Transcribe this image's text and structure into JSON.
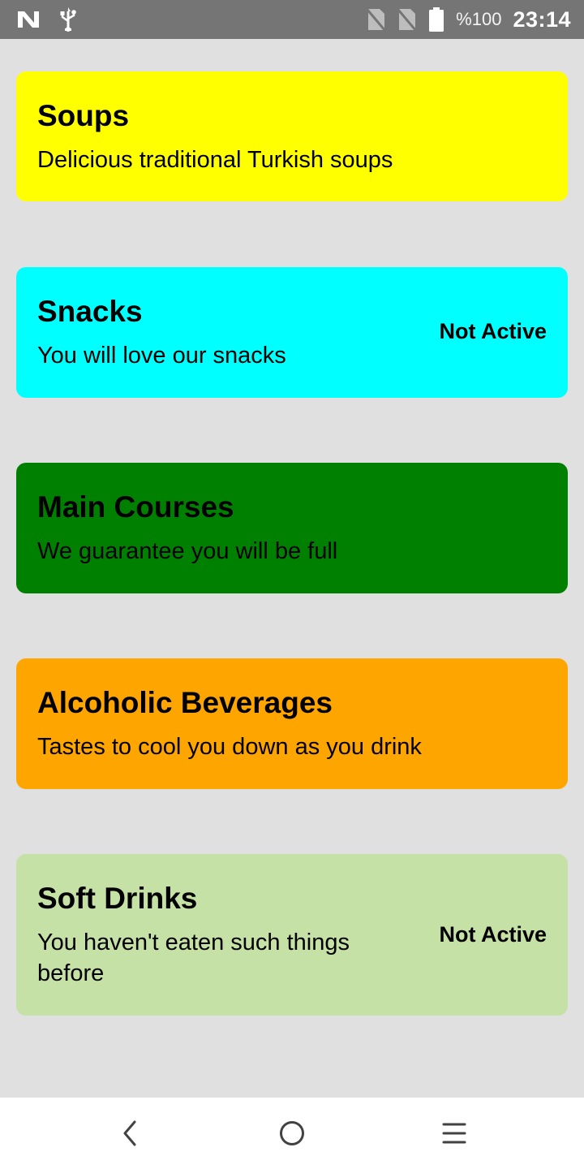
{
  "status_bar": {
    "battery_percent": "%100",
    "time": "23:14",
    "icons": [
      "n-notification-icon",
      "usb-icon",
      "no-sim-icon",
      "no-sim-icon",
      "battery-icon"
    ]
  },
  "categories": [
    {
      "title": "Soups",
      "description": "Delicious traditional Turkish soups",
      "status": "",
      "color": "#ffff00"
    },
    {
      "title": "Snacks",
      "description": "You will love our snacks",
      "status": "Not Active",
      "color": "#00ffff"
    },
    {
      "title": "Main Courses",
      "description": "We guarantee you will be full",
      "status": "",
      "color": "#008000"
    },
    {
      "title": "Alcoholic Beverages",
      "description": "Tastes to cool you down as you drink",
      "status": "",
      "color": "#ffa500"
    },
    {
      "title": "Soft Drinks",
      "description": "You haven't eaten such things before",
      "status": "Not Active",
      "color": "#c5e1a5"
    }
  ],
  "nav_bar": {
    "icons": [
      "back-icon",
      "home-icon",
      "menu-icon"
    ]
  }
}
